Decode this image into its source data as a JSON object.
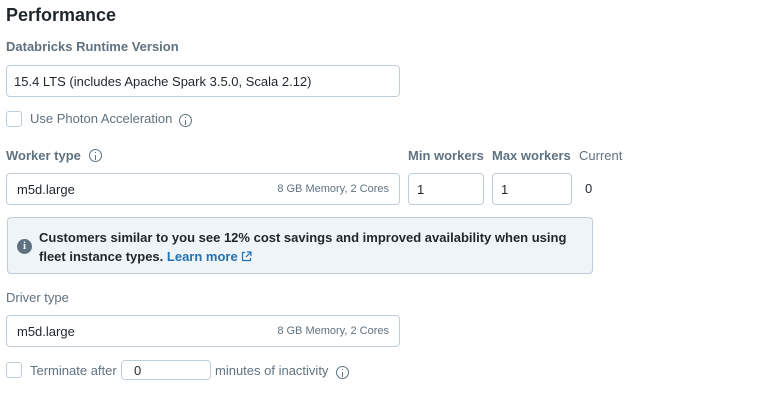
{
  "section_title": "Performance",
  "runtime": {
    "label": "Databricks Runtime Version",
    "value": "15.4 LTS (includes Apache Spark 3.5.0, Scala 2.12)"
  },
  "photon": {
    "label": "Use Photon Acceleration",
    "checked": false
  },
  "workers": {
    "worker_type_label": "Worker type",
    "worker_type_value": "m5d.large",
    "worker_type_spec": "8 GB Memory, 2 Cores",
    "min_label": "Min workers",
    "min_value": "1",
    "max_label": "Max workers",
    "max_value": "1",
    "current_label": "Current",
    "current_value": "0"
  },
  "banner": {
    "text": "Customers similar to you see 12% cost savings and improved availability when using fleet instance types.",
    "link": "Learn more"
  },
  "driver": {
    "label": "Driver type",
    "value": "m5d.large",
    "spec": "8 GB Memory, 2 Cores"
  },
  "terminate": {
    "label": "Terminate after",
    "minutes_value": "0",
    "suffix": "minutes of inactivity",
    "checked": false
  }
}
